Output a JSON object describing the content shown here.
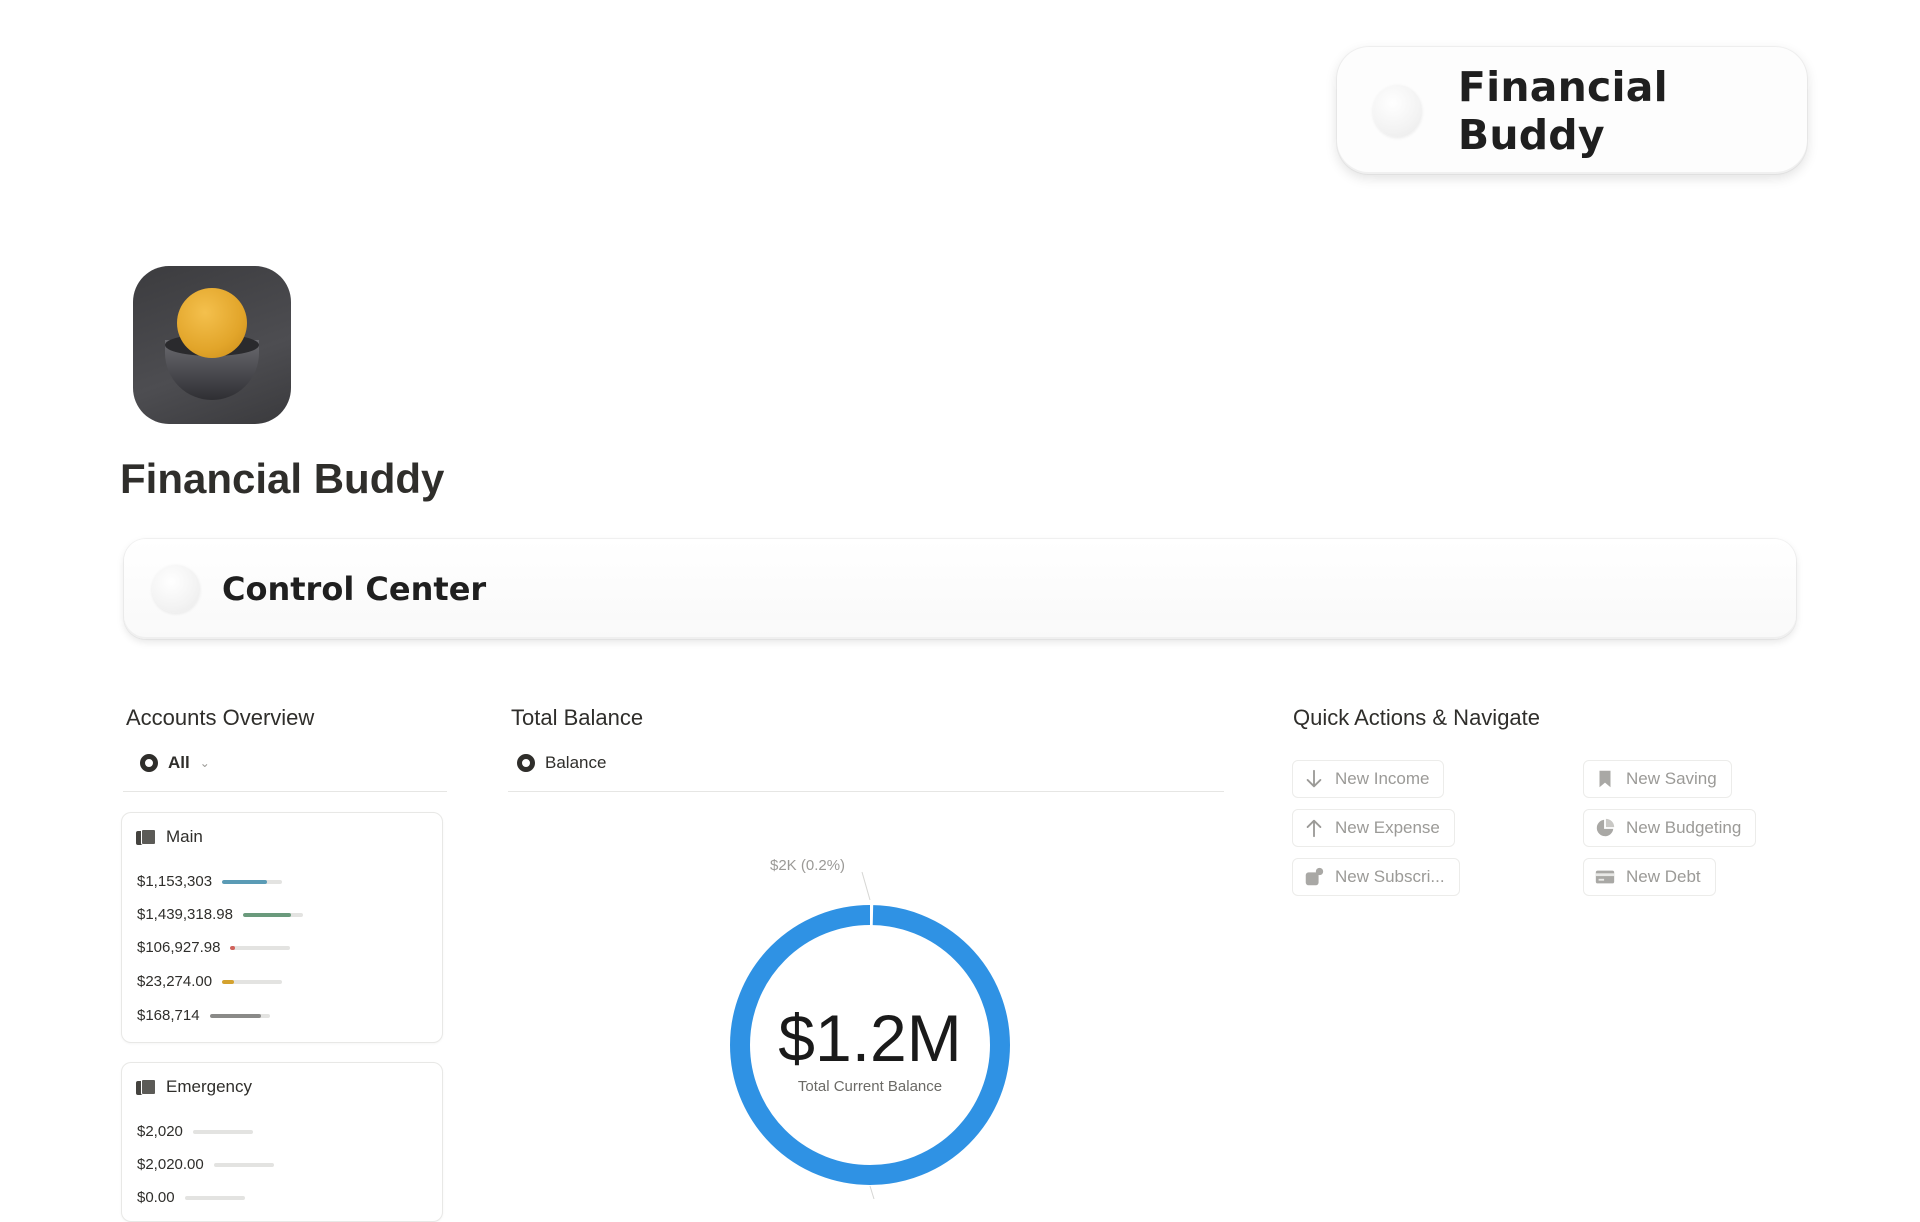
{
  "header_badge": {
    "title": "Financial Buddy"
  },
  "page": {
    "title": "Financial Buddy"
  },
  "banner": {
    "title": "Control Center"
  },
  "accounts_overview": {
    "title": "Accounts Overview",
    "view_tab": "All",
    "cards": [
      {
        "name": "Main",
        "rows": [
          {
            "amount": "$1,153,303",
            "fill": 0.75,
            "color": "#5a9bb5"
          },
          {
            "amount": "$1,439,318.98",
            "fill": 0.8,
            "color": "#6a9a7c"
          },
          {
            "amount": "$106,927.98",
            "fill": 0.08,
            "color": "#d0625b"
          },
          {
            "amount": "$23,274.00",
            "fill": 0.2,
            "color": "#d4a22e"
          },
          {
            "amount": "$168,714",
            "fill": 0.85,
            "color": "#8a8a88"
          }
        ]
      },
      {
        "name": "Emergency",
        "rows": [
          {
            "amount": "$2,020",
            "fill": 0,
            "color": "#8a8a88"
          },
          {
            "amount": "$2,020.00",
            "fill": 0,
            "color": "#8a8a88"
          },
          {
            "amount": "$0.00",
            "fill": 0,
            "color": "#8a8a88"
          }
        ]
      }
    ]
  },
  "total_balance": {
    "title": "Total Balance",
    "view_tab": "Balance",
    "donut": {
      "value": "$1.2M",
      "caption": "Total Current Balance",
      "annotation": "$2K (0.2%)",
      "small_share": 0.002,
      "color": "#2f92e4"
    }
  },
  "quick_actions": {
    "title": "Quick Actions & Navigate",
    "buttons": [
      {
        "label": "New Income",
        "icon": "arrow-down-icon"
      },
      {
        "label": "New Expense",
        "icon": "arrow-up-icon"
      },
      {
        "label": "New Subscri...",
        "icon": "subscription-icon"
      },
      {
        "label": "New Saving",
        "icon": "bookmark-icon"
      },
      {
        "label": "New Budgeting",
        "icon": "pie-chart-icon"
      },
      {
        "label": "New Debt",
        "icon": "credit-card-icon"
      }
    ]
  }
}
